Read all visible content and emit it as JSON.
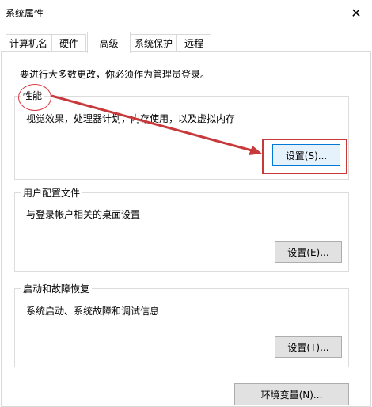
{
  "window": {
    "title": "系统属性",
    "close_icon": "close-icon"
  },
  "tabs": [
    {
      "label": "计算机名",
      "active": false
    },
    {
      "label": "硬件",
      "active": false
    },
    {
      "label": "高级",
      "active": true
    },
    {
      "label": "系统保护",
      "active": false
    },
    {
      "label": "远程",
      "active": false
    }
  ],
  "advanced": {
    "admin_note": "要进行大多数更改，你必须作为管理员登录。",
    "performance": {
      "label": "性能",
      "description": "视觉效果，处理器计划，内存使用，以及虚拟内存",
      "button": "设置(S)..."
    },
    "user_profiles": {
      "label": "用户配置文件",
      "description": "与登录帐户相关的桌面设置",
      "button": "设置(E)..."
    },
    "startup_recovery": {
      "label": "启动和故障恢复",
      "description": "系统启动、系统故障和调试信息",
      "button": "设置(T)..."
    },
    "env_button": "环境变量(N)..."
  },
  "annotation": {
    "color": "#c8393b"
  }
}
